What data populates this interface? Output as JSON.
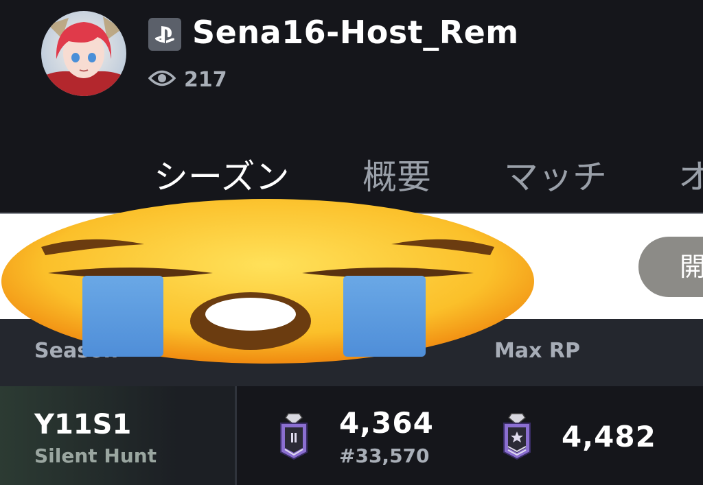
{
  "profile": {
    "platform_icon": "playstation-icon",
    "username": "Sena16-Host_Rem",
    "views_icon": "eye-icon",
    "views": "217"
  },
  "tabs": [
    {
      "label": "シーズン",
      "active": true
    },
    {
      "label": "概要",
      "active": false
    },
    {
      "label": "マッチ",
      "active": false
    },
    {
      "label": "オ",
      "active": false
    }
  ],
  "panel": {
    "button_label": "開"
  },
  "table": {
    "headers": [
      "Season",
      "Max RP"
    ],
    "row": {
      "season_code": "Y11S1",
      "season_name": "Silent Hunt",
      "rp": "4,364",
      "rank_position": "#33,570",
      "max_rp": "4,482"
    }
  },
  "overlay": {
    "icon": "crying-face-emoji"
  },
  "colors": {
    "background": "#15161b",
    "header_row": "#24272e",
    "rank_purple": "#8b6fd1"
  }
}
